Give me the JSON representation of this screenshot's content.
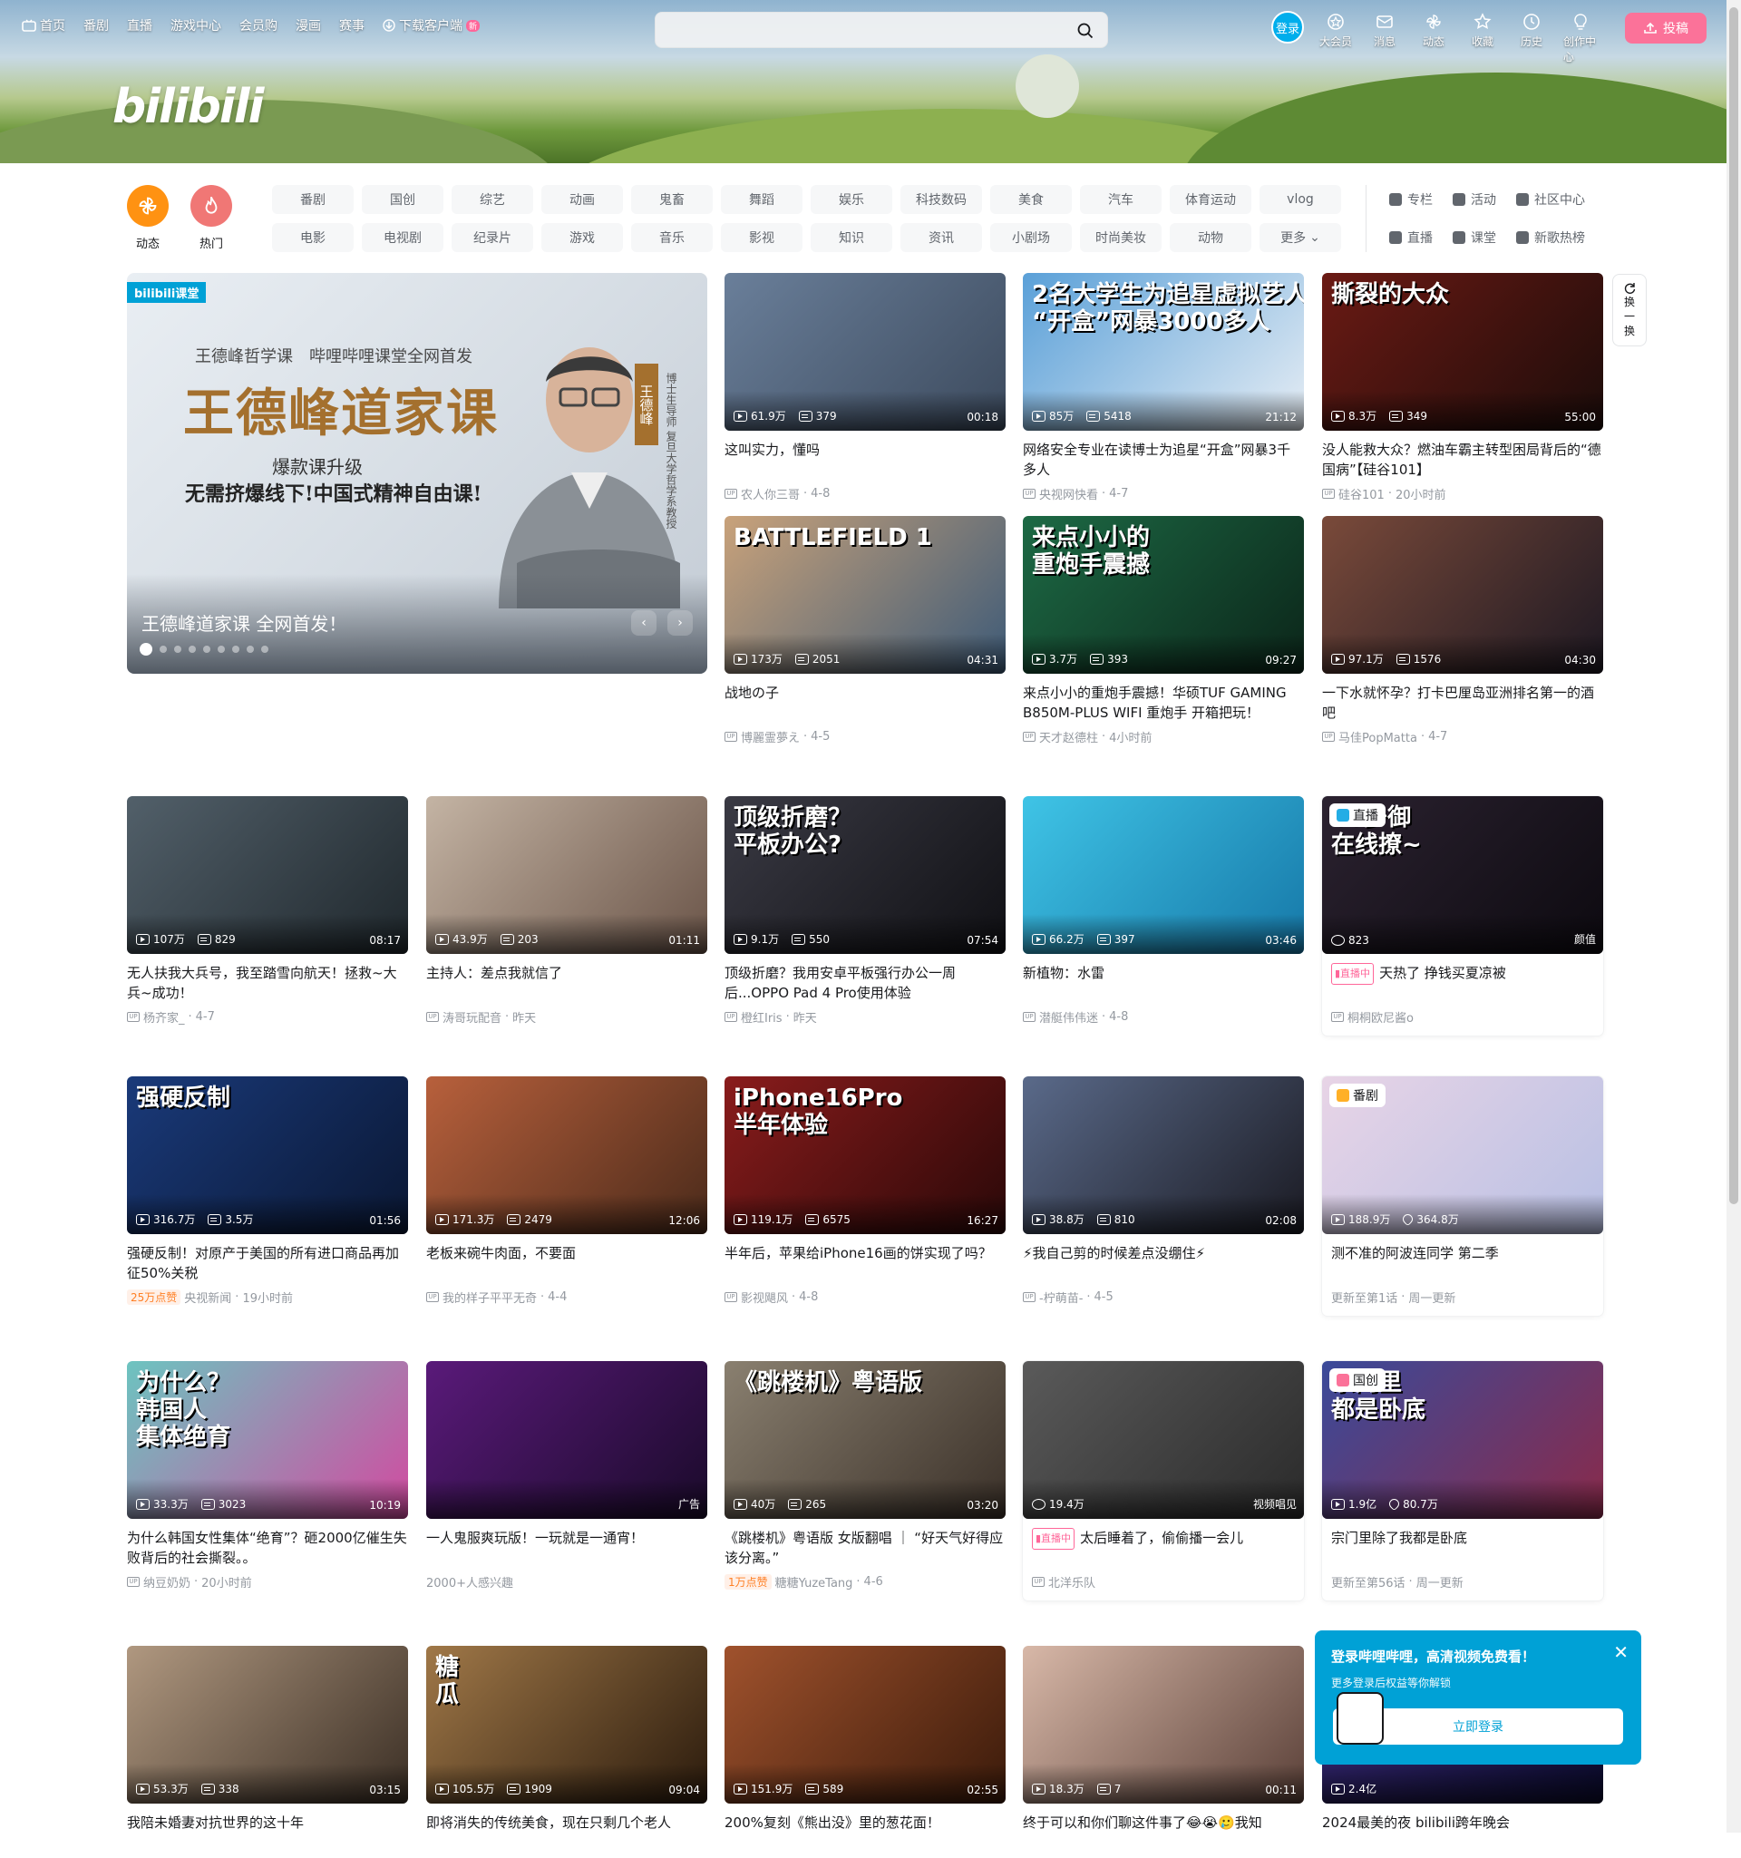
{
  "topnav": {
    "items": [
      "首页",
      "番剧",
      "直播",
      "游戏中心",
      "会员购",
      "漫画",
      "赛事",
      "下载客户端"
    ],
    "new_tag": "新"
  },
  "search": {
    "placeholder": ""
  },
  "rightnav": {
    "login": "登录",
    "items": [
      "大会员",
      "消息",
      "动态",
      "收藏",
      "历史",
      "创作中心"
    ],
    "upload": "投稿"
  },
  "channels": {
    "dynamic": "动态",
    "hot": "热门",
    "grid": [
      "番剧",
      "国创",
      "综艺",
      "动画",
      "鬼畜",
      "舞蹈",
      "娱乐",
      "科技数码",
      "美食",
      "汽车",
      "体育运动",
      "vlog",
      "电影",
      "电视剧",
      "纪录片",
      "游戏",
      "音乐",
      "影视",
      "知识",
      "资讯",
      "小剧场",
      "时尚美妆",
      "动物",
      "更多"
    ],
    "links": [
      "专栏",
      "活动",
      "社区中心",
      "直播",
      "课堂",
      "新歌热榜"
    ]
  },
  "carousel": {
    "tag": "bilibili课堂",
    "sub": "王德峰哲学课　哔哩哔哩课堂全网首发",
    "big": "王德峰道家课",
    "line1": "爆款课升级",
    "line2": "无需挤爆线下!中国式精神自由课!",
    "vtag": "王德峰",
    "vtag2": "博士生导师 复旦大学哲学系教授",
    "title": "王德峰道家课 全网首发！"
  },
  "refresh": [
    "换",
    "一",
    "换"
  ],
  "logo": "bilibili",
  "videos": [
    {
      "thumb_text": "",
      "views": "61.9万",
      "dm": "379",
      "dur": "00:18",
      "title": "这叫实力，懂吗",
      "up": "农人你三哥",
      "date": "4-8",
      "c1": "#6a7f9a",
      "c2": "#3c4a5d"
    },
    {
      "thumb_text": "2名大学生为追星虚拟艺人\n“开盒”网暴3000多人",
      "views": "85万",
      "dm": "5418",
      "dur": "21:12",
      "title": "网络安全专业在读博士为追星“开盒”网暴3千多人",
      "up": "央视网快看",
      "date": "4-7",
      "c1": "#5aa0d8",
      "c2": "#e6edf4"
    },
    {
      "thumb_text": "撕裂的大众",
      "views": "8.3万",
      "dm": "349",
      "dur": "55:00",
      "title": "没人能救大众？燃油车霸主转型困局背后的“德国病”【硅谷101】",
      "up": "硅谷101",
      "date": "20小时前",
      "c1": "#6b1a14",
      "c2": "#1c0c0a"
    },
    {
      "thumb_text": "BATTLEFIELD 1",
      "views": "173万",
      "dm": "2051",
      "dur": "04:31",
      "title": "战地の子",
      "up": "博麗霊夢え",
      "date": "4-5",
      "c1": "#c9a27a",
      "c2": "#3d5a77"
    },
    {
      "thumb_text": "来点小小的\n重炮手震撼",
      "views": "3.7万",
      "dm": "393",
      "dur": "09:27",
      "title": "来点小小的重炮手震撼！华硕TUF GAMING B850M-PLUS WIFI 重炮手 开箱把玩！",
      "up": "天才赵德柱",
      "date": "4小时前",
      "c1": "#1d6a45",
      "c2": "#0b2519"
    },
    {
      "thumb_text": "",
      "views": "97.1万",
      "dm": "1576",
      "dur": "04:30",
      "title": "一下水就怀孕？打卡巴厘岛亚洲排名第一的酒吧",
      "up": "马佳PopMatta",
      "date": "4-7",
      "c1": "#7a4a3a",
      "c2": "#1d1822"
    },
    {
      "thumb_text": "",
      "views": "107万",
      "dm": "829",
      "dur": "08:17",
      "title": "无人扶我大兵号，我至踏雪向航天！拯救~大兵~成功！",
      "up": "杨齐家_",
      "date": "4-7",
      "c1": "#52606a",
      "c2": "#1f272c"
    },
    {
      "thumb_text": "",
      "views": "43.9万",
      "dm": "203",
      "dur": "01:11",
      "title": "主持人：差点我就信了",
      "up": "涛哥玩配音",
      "date": "昨天",
      "c1": "#c4b4a4",
      "c2": "#6a5448"
    },
    {
      "thumb_text": "顶级折磨？\n平板办公?",
      "views": "9.1万",
      "dm": "550",
      "dur": "07:54",
      "title": "顶级折磨？我用安卓平板强行办公一周后...OPPO Pad 4 Pro使用体验",
      "up": "橙红Iris",
      "date": "昨天",
      "c1": "#3a3a44",
      "c2": "#101014"
    },
    {
      "thumb_text": "",
      "views": "66.2万",
      "dm": "397",
      "dur": "03:46",
      "title": "新植物：水雷",
      "up": "潜艇伟伟迷",
      "date": "4-8",
      "c1": "#3fc4e6",
      "c2": "#1678a8"
    },
    {
      "live": true,
      "thumb_text": "05少御\n在线撩~",
      "viewers": "823",
      "tag": "颜值",
      "title": "天热了 挣钱买夏凉被",
      "up": "桐桐欧尼酱o",
      "ptag": "直播",
      "ptagc": "#23ade5",
      "c1": "#2b2230",
      "c2": "#0d0a10"
    },
    {
      "thumb_text": "强硬反制",
      "views": "316.7万",
      "dm": "3.5万",
      "dur": "01:56",
      "title": "强硬反制！对原产于美国的所有进口商品再加征50%关税",
      "up": "央视新闻",
      "date": "19小时前",
      "hl": "25万点赞",
      "c1": "#1a3a7a",
      "c2": "#0a1733"
    },
    {
      "thumb_text": "",
      "views": "171.3万",
      "dm": "2479",
      "dur": "12:06",
      "title": "老板来碗牛肉面，不要面",
      "up": "我的样子平平无奇",
      "date": "4-4",
      "c1": "#b8603c",
      "c2": "#4a2a1a"
    },
    {
      "thumb_text": "iPhone16Pro\n半年体验",
      "views": "119.1万",
      "dm": "6575",
      "dur": "16:27",
      "title": "半年后，苹果给iPhone16画的饼实现了吗？",
      "up": "影视飓风",
      "date": "4-8",
      "c1": "#8a1c1c",
      "c2": "#2a0808"
    },
    {
      "thumb_text": "",
      "views": "38.8万",
      "dm": "810",
      "dur": "02:08",
      "title": "⚡我自己剪的时候差点没绷住⚡",
      "up": "-柠萌苗-",
      "date": "4-5",
      "c1": "#5a6a8a",
      "c2": "#1a1a22"
    },
    {
      "bangumi": true,
      "thumb_text": "",
      "views": "188.9万",
      "likes": "364.8万",
      "title": "测不准的阿波连同学 第二季",
      "sub": "更新至第1话",
      "sub2": "周一更新",
      "ptag": "番剧",
      "ptagc": "#ffb027",
      "c1": "#e8d4e6",
      "c2": "#b8c0e4"
    },
    {
      "thumb_text": "为什么？\n韩国人\n集体绝育",
      "views": "33.3万",
      "dm": "3023",
      "dur": "10:19",
      "title": "为什么韩国女性集体“绝育”？砸2000亿催生失败背后的社会撕裂。。",
      "up": "纳豆奶奶",
      "date": "20小时前",
      "c1": "#6cc4c0",
      "c2": "#d24aa0"
    },
    {
      "ad": true,
      "thumb_text": "",
      "tag": "广告",
      "title": "一人鬼服爽玩版！一玩就是一通宵！",
      "sub": "2000+人感兴趣",
      "c1": "#5a1a7a",
      "c2": "#1a0a2a"
    },
    {
      "thumb_text": "《跳楼机》粤语版",
      "views": "40万",
      "dm": "265",
      "dur": "03:20",
      "title": "《跳楼机》粤语版 女版翻唱 ｜ “好天气好得应该分离。”",
      "up": "糖糖YuzeTang",
      "date": "4-6",
      "hl": "1万点赞",
      "c1": "#8a8070",
      "c2": "#3a3028"
    },
    {
      "live": true,
      "thumb_text": "",
      "viewers": "19.4万",
      "tag": "视频唱见",
      "title": "太后睡着了，偷偷播一会儿",
      "up": "北洋乐队",
      "c1": "#5a5a5a",
      "c2": "#2a2a2a"
    },
    {
      "bangumi": true,
      "thumb_text": "宗门里\n都是卧底",
      "views": "1.9亿",
      "likes": "80.7万",
      "title": "宗门里除了我都是卧底",
      "sub": "更新至第56话",
      "sub2": "周一更新",
      "ptag": "国创",
      "ptagc": "#fb7299",
      "c1": "#3a4a9a",
      "c2": "#8a2a4a"
    },
    {
      "thumb_text": "",
      "views": "53.3万",
      "dm": "338",
      "dur": "03:15",
      "title": "我陪未婚妻对抗世界的这十年",
      "up": "",
      "date": "",
      "c1": "#b09880",
      "c2": "#3a2e24"
    },
    {
      "thumb_text": "糖\n瓜",
      "views": "105.5万",
      "dm": "1909",
      "dur": "09:04",
      "title": "即将消失的传统美食，现在只剩几个老人",
      "up": "",
      "date": "",
      "c1": "#a07848",
      "c2": "#2a1a0c"
    },
    {
      "thumb_text": "",
      "views": "151.9万",
      "dm": "589",
      "dur": "02:55",
      "title": "200%复刻《熊出没》里的葱花面！",
      "up": "",
      "date": "",
      "c1": "#a0522d",
      "c2": "#3a1a0a"
    },
    {
      "thumb_text": "",
      "views": "18.3万",
      "dm": "7",
      "dur": "00:11",
      "title": "终于可以和你们聊这件事了😂😭🥲我知",
      "up": "",
      "date": "",
      "c1": "#d8b8a8",
      "c2": "#5a4038"
    },
    {
      "thumb_text": "",
      "views": "2.4亿",
      "dm": "",
      "dur": "",
      "title": "2024最美的夜 bilibili跨年晚会",
      "up": "",
      "date": "",
      "c1": "#3a2a7a",
      "c2": "#0a0a2a"
    }
  ],
  "popup": {
    "title": "登录哔哩哔哩，高清视频免费看！",
    "sub": "更多登录后权益等你解锁",
    "button": "立即登录"
  }
}
